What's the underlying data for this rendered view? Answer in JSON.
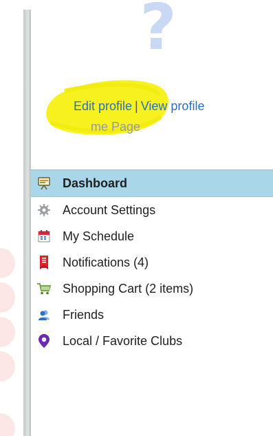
{
  "profile": {
    "edit_label": "Edit profile",
    "separator": "|",
    "view_label": "View profile",
    "home_label": "me Page"
  },
  "menu": {
    "items": [
      {
        "label": "Dashboard",
        "icon": "dashboard-icon",
        "active": true
      },
      {
        "label": "Account Settings",
        "icon": "gear-icon",
        "active": false
      },
      {
        "label": "My Schedule",
        "icon": "calendar-icon",
        "active": false
      },
      {
        "label": "Notifications (4)",
        "icon": "notification-icon",
        "active": false
      },
      {
        "label": "Shopping Cart (2 items)",
        "icon": "cart-icon",
        "active": false
      },
      {
        "label": "Friends",
        "icon": "friends-icon",
        "active": false
      },
      {
        "label": "Local / Favorite Clubs",
        "icon": "location-pin-icon",
        "active": false
      }
    ]
  },
  "colors": {
    "active_bg": "#a9d6e8",
    "link": "#2a6fc1",
    "highlight": "#f7f21f"
  }
}
